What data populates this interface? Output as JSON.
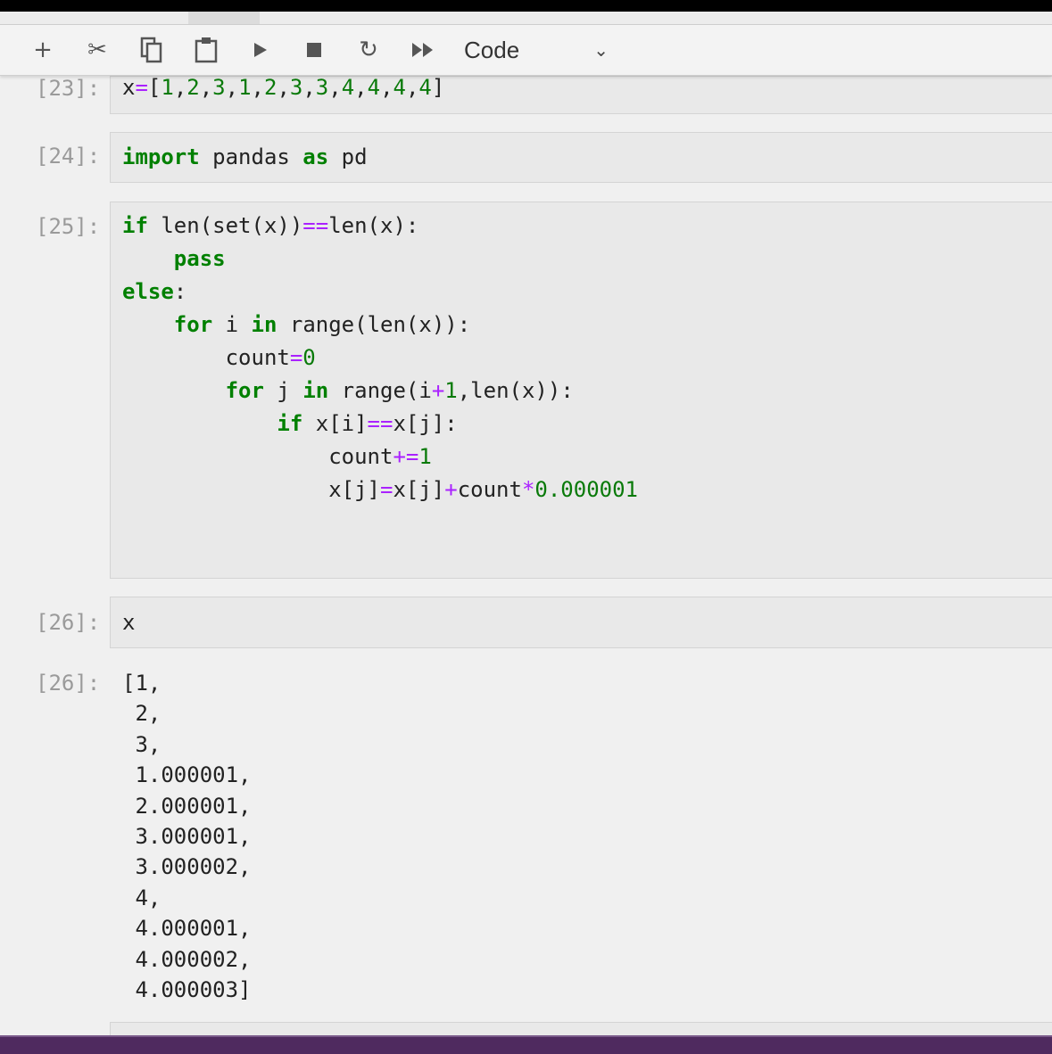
{
  "toolbar": {
    "cell_type": "Code",
    "buttons": [
      "plus-icon",
      "scissors-icon",
      "copy-icon",
      "paste-icon",
      "run-icon",
      "stop-icon",
      "restart-icon",
      "fast-forward-icon"
    ]
  },
  "cells": [
    {
      "prompt": "[23]:",
      "lines": [
        [
          [
            "x",
            "b"
          ],
          [
            "=",
            "o"
          ],
          [
            "[",
            "b"
          ],
          [
            "1",
            "n"
          ],
          [
            ",",
            "b"
          ],
          [
            "2",
            "n"
          ],
          [
            ",",
            "b"
          ],
          [
            "3",
            "n"
          ],
          [
            ",",
            "b"
          ],
          [
            "1",
            "n"
          ],
          [
            ",",
            "b"
          ],
          [
            "2",
            "n"
          ],
          [
            ",",
            "b"
          ],
          [
            "3",
            "n"
          ],
          [
            ",",
            "b"
          ],
          [
            "3",
            "n"
          ],
          [
            ",",
            "b"
          ],
          [
            "4",
            "n"
          ],
          [
            ",",
            "b"
          ],
          [
            "4",
            "n"
          ],
          [
            ",",
            "b"
          ],
          [
            "4",
            "n"
          ],
          [
            ",",
            "b"
          ],
          [
            "4",
            "n"
          ],
          [
            "]",
            "b"
          ]
        ]
      ]
    },
    {
      "prompt": "[24]:",
      "lines": [
        [
          [
            "import",
            "k"
          ],
          [
            " pandas ",
            "b"
          ],
          [
            "as",
            "k"
          ],
          [
            " pd",
            "b"
          ]
        ]
      ]
    },
    {
      "prompt": "[25]:",
      "lines": [
        [
          [
            "if",
            "k"
          ],
          [
            " len(set(x))",
            "b"
          ],
          [
            "==",
            "o"
          ],
          [
            "len(x):",
            "b"
          ]
        ],
        [
          [
            "    ",
            "b"
          ],
          [
            "pass",
            "k"
          ]
        ],
        [
          [
            "else",
            "k"
          ],
          [
            ":",
            "b"
          ]
        ],
        [
          [
            "    ",
            "b"
          ],
          [
            "for",
            "k"
          ],
          [
            " i ",
            "b"
          ],
          [
            "in",
            "k"
          ],
          [
            " range(len(x)):",
            "b"
          ]
        ],
        [
          [
            "        count",
            "b"
          ],
          [
            "=",
            "o"
          ],
          [
            "0",
            "n"
          ]
        ],
        [
          [
            "        ",
            "b"
          ],
          [
            "for",
            "k"
          ],
          [
            " j ",
            "b"
          ],
          [
            "in",
            "k"
          ],
          [
            " range(i",
            "b"
          ],
          [
            "+",
            "o"
          ],
          [
            "1",
            "n"
          ],
          [
            ",len(x)):",
            "b"
          ]
        ],
        [
          [
            "            ",
            "b"
          ],
          [
            "if",
            "k"
          ],
          [
            " x[i]",
            "b"
          ],
          [
            "==",
            "o"
          ],
          [
            "x[j]:",
            "b"
          ]
        ],
        [
          [
            "                count",
            "b"
          ],
          [
            "+=",
            "o"
          ],
          [
            "1",
            "n"
          ]
        ],
        [
          [
            "                x[j]",
            "b"
          ],
          [
            "=",
            "o"
          ],
          [
            "x[j]",
            "b"
          ],
          [
            "+",
            "o"
          ],
          [
            "count",
            "b"
          ],
          [
            "*",
            "o"
          ],
          [
            "0.000001",
            "n"
          ]
        ]
      ]
    },
    {
      "prompt": "[26]:",
      "lines": [
        [
          [
            "x",
            "b"
          ]
        ]
      ]
    }
  ],
  "output": {
    "prompt": "[26]:",
    "lines": [
      "[1,",
      " 2,",
      " 3,",
      " 1.000001,",
      " 2.000001,",
      " 3.000001,",
      " 3.000002,",
      " 4,",
      " 4.000001,",
      " 4.000002,",
      " 4.000003]"
    ]
  }
}
